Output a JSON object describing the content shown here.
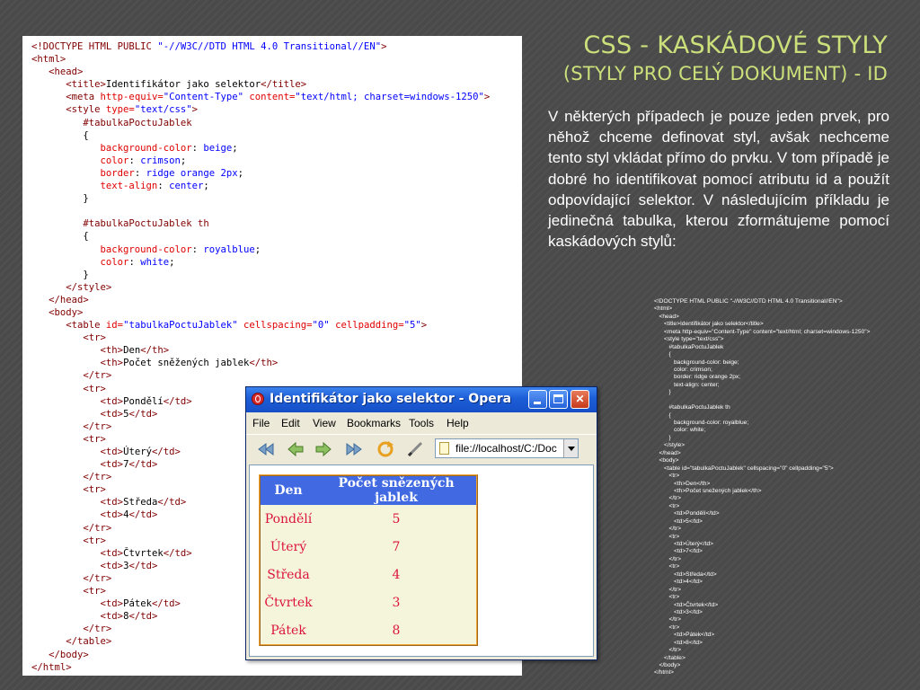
{
  "title": {
    "line1": "CSS - KASKÁDOVÉ STYLY",
    "line2": "(STYLY PRO CELÝ DOKUMENT) - ID"
  },
  "paragraph": "V některých případech je pouze jeden prvek, pro něhož chceme definovat styl, avšak nechceme tento styl vkládat přímo do prvku. V tom případě je dobré ho identifikovat pomocí atributu id a použít odpovídající selektor. V následujícím příkladu je jedinečná tabulka, kterou zformátujeme pomocí kaskádových stylů:",
  "code_lines": [
    [
      {
        "t": "<!DOCTYPE HTML PUBLIC ",
        "c": "tg"
      },
      {
        "t": "\"-//W3C//DTD HTML 4.0 Transitional//EN\"",
        "c": "vl"
      },
      {
        "t": ">",
        "c": "tg"
      }
    ],
    [
      {
        "t": "<html>",
        "c": "tg"
      }
    ],
    [
      {
        "t": "   <head>",
        "c": "tg"
      }
    ],
    [
      {
        "t": "      <title>",
        "c": "tg"
      },
      {
        "t": "Identifikátor jako selektor",
        "c": "tx"
      },
      {
        "t": "</title>",
        "c": "tg"
      }
    ],
    [
      {
        "t": "      <meta ",
        "c": "tg"
      },
      {
        "t": "http-equiv=",
        "c": "at"
      },
      {
        "t": "\"Content-Type\"",
        "c": "vl"
      },
      {
        "t": " content=",
        "c": "at"
      },
      {
        "t": "\"text/html; charset=windows-1250\"",
        "c": "vl"
      },
      {
        "t": ">",
        "c": "tg"
      }
    ],
    [
      {
        "t": "      <style ",
        "c": "tg"
      },
      {
        "t": "type=",
        "c": "at"
      },
      {
        "t": "\"text/css\"",
        "c": "vl"
      },
      {
        "t": ">",
        "c": "tg"
      }
    ],
    [
      {
        "t": "         #tabulkaPoctuJablek",
        "c": "cs"
      }
    ],
    [
      {
        "t": "         {",
        "c": "tx"
      }
    ],
    [
      {
        "t": "            background-color",
        "c": "cp"
      },
      {
        "t": ": ",
        "c": "tx"
      },
      {
        "t": "beige",
        "c": "cv"
      },
      {
        "t": ";",
        "c": "tx"
      }
    ],
    [
      {
        "t": "            color",
        "c": "cp"
      },
      {
        "t": ": ",
        "c": "tx"
      },
      {
        "t": "crimson",
        "c": "cv"
      },
      {
        "t": ";",
        "c": "tx"
      }
    ],
    [
      {
        "t": "            border",
        "c": "cp"
      },
      {
        "t": ": ",
        "c": "tx"
      },
      {
        "t": "ridge orange 2px",
        "c": "cv"
      },
      {
        "t": ";",
        "c": "tx"
      }
    ],
    [
      {
        "t": "            text-align",
        "c": "cp"
      },
      {
        "t": ": ",
        "c": "tx"
      },
      {
        "t": "center",
        "c": "cv"
      },
      {
        "t": ";",
        "c": "tx"
      }
    ],
    [
      {
        "t": "         }",
        "c": "tx"
      }
    ],
    [
      {
        "t": "",
        "c": "tx"
      }
    ],
    [
      {
        "t": "         #tabulkaPoctuJablek th",
        "c": "cs"
      }
    ],
    [
      {
        "t": "         {",
        "c": "tx"
      }
    ],
    [
      {
        "t": "            background-color",
        "c": "cp"
      },
      {
        "t": ": ",
        "c": "tx"
      },
      {
        "t": "royalblue",
        "c": "cv"
      },
      {
        "t": ";",
        "c": "tx"
      }
    ],
    [
      {
        "t": "            color",
        "c": "cp"
      },
      {
        "t": ": ",
        "c": "tx"
      },
      {
        "t": "white",
        "c": "cv"
      },
      {
        "t": ";",
        "c": "tx"
      }
    ],
    [
      {
        "t": "         }",
        "c": "tx"
      }
    ],
    [
      {
        "t": "      </style>",
        "c": "tg"
      }
    ],
    [
      {
        "t": "   </head>",
        "c": "tg"
      }
    ],
    [
      {
        "t": "   <body>",
        "c": "tg"
      }
    ],
    [
      {
        "t": "      <table ",
        "c": "tg"
      },
      {
        "t": "id=",
        "c": "at"
      },
      {
        "t": "\"tabulkaPoctuJablek\"",
        "c": "vl"
      },
      {
        "t": " cellspacing=",
        "c": "at"
      },
      {
        "t": "\"0\"",
        "c": "vl"
      },
      {
        "t": " cellpadding=",
        "c": "at"
      },
      {
        "t": "\"5\"",
        "c": "vl"
      },
      {
        "t": ">",
        "c": "tg"
      }
    ],
    [
      {
        "t": "         <tr>",
        "c": "tg"
      }
    ],
    [
      {
        "t": "            <th>",
        "c": "tg"
      },
      {
        "t": "Den",
        "c": "tx"
      },
      {
        "t": "</th>",
        "c": "tg"
      }
    ],
    [
      {
        "t": "            <th>",
        "c": "tg"
      },
      {
        "t": "Počet sněžených jablek",
        "c": "tx"
      },
      {
        "t": "</th>",
        "c": "tg"
      }
    ],
    [
      {
        "t": "         </tr>",
        "c": "tg"
      }
    ],
    [
      {
        "t": "         <tr>",
        "c": "tg"
      }
    ],
    [
      {
        "t": "            <td>",
        "c": "tg"
      },
      {
        "t": "Pondělí",
        "c": "tx"
      },
      {
        "t": "</td>",
        "c": "tg"
      }
    ],
    [
      {
        "t": "            <td>",
        "c": "tg"
      },
      {
        "t": "5",
        "c": "tx"
      },
      {
        "t": "</td>",
        "c": "tg"
      }
    ],
    [
      {
        "t": "         </tr>",
        "c": "tg"
      }
    ],
    [
      {
        "t": "         <tr>",
        "c": "tg"
      }
    ],
    [
      {
        "t": "            <td>",
        "c": "tg"
      },
      {
        "t": "Úterý",
        "c": "tx"
      },
      {
        "t": "</td>",
        "c": "tg"
      }
    ],
    [
      {
        "t": "            <td>",
        "c": "tg"
      },
      {
        "t": "7",
        "c": "tx"
      },
      {
        "t": "</td>",
        "c": "tg"
      }
    ],
    [
      {
        "t": "         </tr>",
        "c": "tg"
      }
    ],
    [
      {
        "t": "         <tr>",
        "c": "tg"
      }
    ],
    [
      {
        "t": "            <td>",
        "c": "tg"
      },
      {
        "t": "Středa",
        "c": "tx"
      },
      {
        "t": "</td>",
        "c": "tg"
      }
    ],
    [
      {
        "t": "            <td>",
        "c": "tg"
      },
      {
        "t": "4",
        "c": "tx"
      },
      {
        "t": "</td>",
        "c": "tg"
      }
    ],
    [
      {
        "t": "         </tr>",
        "c": "tg"
      }
    ],
    [
      {
        "t": "         <tr>",
        "c": "tg"
      }
    ],
    [
      {
        "t": "            <td>",
        "c": "tg"
      },
      {
        "t": "Čtvrtek",
        "c": "tx"
      },
      {
        "t": "</td>",
        "c": "tg"
      }
    ],
    [
      {
        "t": "            <td>",
        "c": "tg"
      },
      {
        "t": "3",
        "c": "tx"
      },
      {
        "t": "</td>",
        "c": "tg"
      }
    ],
    [
      {
        "t": "         </tr>",
        "c": "tg"
      }
    ],
    [
      {
        "t": "         <tr>",
        "c": "tg"
      }
    ],
    [
      {
        "t": "            <td>",
        "c": "tg"
      },
      {
        "t": "Pátek",
        "c": "tx"
      },
      {
        "t": "</td>",
        "c": "tg"
      }
    ],
    [
      {
        "t": "            <td>",
        "c": "tg"
      },
      {
        "t": "8",
        "c": "tx"
      },
      {
        "t": "</td>",
        "c": "tg"
      }
    ],
    [
      {
        "t": "         </tr>",
        "c": "tg"
      }
    ],
    [
      {
        "t": "      </table>",
        "c": "tg"
      }
    ],
    [
      {
        "t": "   </body>",
        "c": "tg"
      }
    ],
    [
      {
        "t": "</html>",
        "c": "tg"
      }
    ]
  ],
  "small_code_lines": [
    "<!DOCTYPE HTML PUBLIC \"-//W3C//DTD HTML 4.0 Transitional//EN\">",
    "<html>",
    "   <head>",
    "      <title>Identifikátor jako selektor</title>",
    "      <meta http-equiv=\"Content-Type\" content=\"text/html; charset=windows-1250\">",
    "      <style type=\"text/css\">",
    "         #tabulkaPoctuJablek",
    "         {",
    "            background-color: beige;",
    "            color: crimson;",
    "            border: ridge orange 2px;",
    "            text-align: center;",
    "         }",
    "",
    "         #tabulkaPoctuJablek th",
    "         {",
    "            background-color: royalblue;",
    "            color: white;",
    "         }",
    "      </style>",
    "   </head>",
    "   <body>",
    "      <table id=\"tabulkaPoctuJablek\" cellspacing=\"0\" cellpadding=\"5\">",
    "         <tr>",
    "            <th>Den</th>",
    "            <th>Počet snežených jablek</th>",
    "         </tr>",
    "         <tr>",
    "            <td>Pondělí</td>",
    "            <td>5</td>",
    "         </tr>",
    "         <tr>",
    "            <td>Úterý</td>",
    "            <td>7</td>",
    "         </tr>",
    "         <tr>",
    "            <td>Středa</td>",
    "            <td>4</td>",
    "         </tr>",
    "         <tr>",
    "            <td>Čtvrtek</td>",
    "            <td>3</td>",
    "         </tr>",
    "         <tr>",
    "            <td>Pátek</td>",
    "            <td>8</td>",
    "         </tr>",
    "      </table>",
    "   </body>",
    "</html>"
  ],
  "browser": {
    "window_title": "Identifikátor jako selektor - Opera",
    "menu": [
      "File",
      "Edit",
      "View",
      "Bookmarks",
      "Tools",
      "Help"
    ],
    "address": "file://localhost/C:/Doc",
    "table": {
      "headers": [
        "Den",
        "Počet snězených jablek"
      ],
      "rows": [
        [
          "Pondělí",
          "5"
        ],
        [
          "Úterý",
          "7"
        ],
        [
          "Středa",
          "4"
        ],
        [
          "Čtvrtek",
          "3"
        ],
        [
          "Pátek",
          "8"
        ]
      ]
    }
  },
  "colors": {
    "title": "#cbe07a",
    "table_bg": "beige",
    "table_text": "crimson",
    "header_bg": "royalblue"
  },
  "icons": [
    "back-icon",
    "forward-icon",
    "fast-forward-icon",
    "reload-icon",
    "edit-icon",
    "page-icon",
    "dropdown-arrow-icon",
    "app-icon",
    "minimize-icon",
    "maximize-icon",
    "close-icon"
  ]
}
